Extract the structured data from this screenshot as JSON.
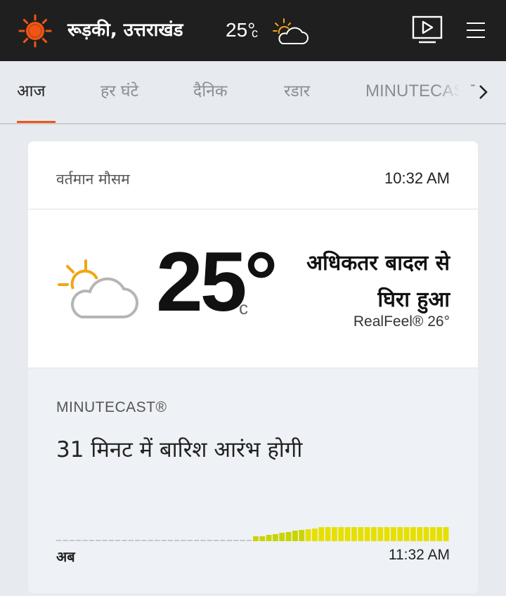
{
  "header": {
    "location": "रूड़की, उत्तराखंड",
    "temp": "25°",
    "unit": "c",
    "logo_icon": "sun-logo-icon",
    "weather_icon": "partly-cloudy-icon",
    "video_icon": "video-icon",
    "menu_icon": "hamburger-menu-icon",
    "brand_color": "#f05514"
  },
  "tabs": [
    {
      "label": "आज"
    },
    {
      "label": "हर घंटे"
    },
    {
      "label": "दैनिक"
    },
    {
      "label": "रडार"
    },
    {
      "label": "MINUTECAST"
    }
  ],
  "current": {
    "title": "वर्तमान मौसम",
    "time": "10:32 AM",
    "temp": "25°",
    "unit": "c",
    "condition_line1": "अधिकतर बादल से",
    "condition_line2": "घिरा हुआ",
    "realfeel": "RealFeel® 26°",
    "icon": "partly-cloudy-icon"
  },
  "minutecast": {
    "label": "MINUTECAST®",
    "text": "31 मिनट में बारिश आरंभ होगी",
    "start_label": "अब",
    "end_label": "11:32 AM",
    "dry_minutes": 30,
    "rain_minutes": 30,
    "rain_levels": [
      0.35,
      0.35,
      0.45,
      0.5,
      0.6,
      0.65,
      0.75,
      0.8,
      0.85,
      0.9,
      1,
      1,
      1,
      1,
      1,
      1,
      1,
      1,
      1,
      1,
      1,
      1,
      1,
      1,
      1,
      1,
      1,
      1,
      1,
      1
    ],
    "rain_color_light": "#c9d400",
    "rain_color_heavy": "#e5e000"
  }
}
